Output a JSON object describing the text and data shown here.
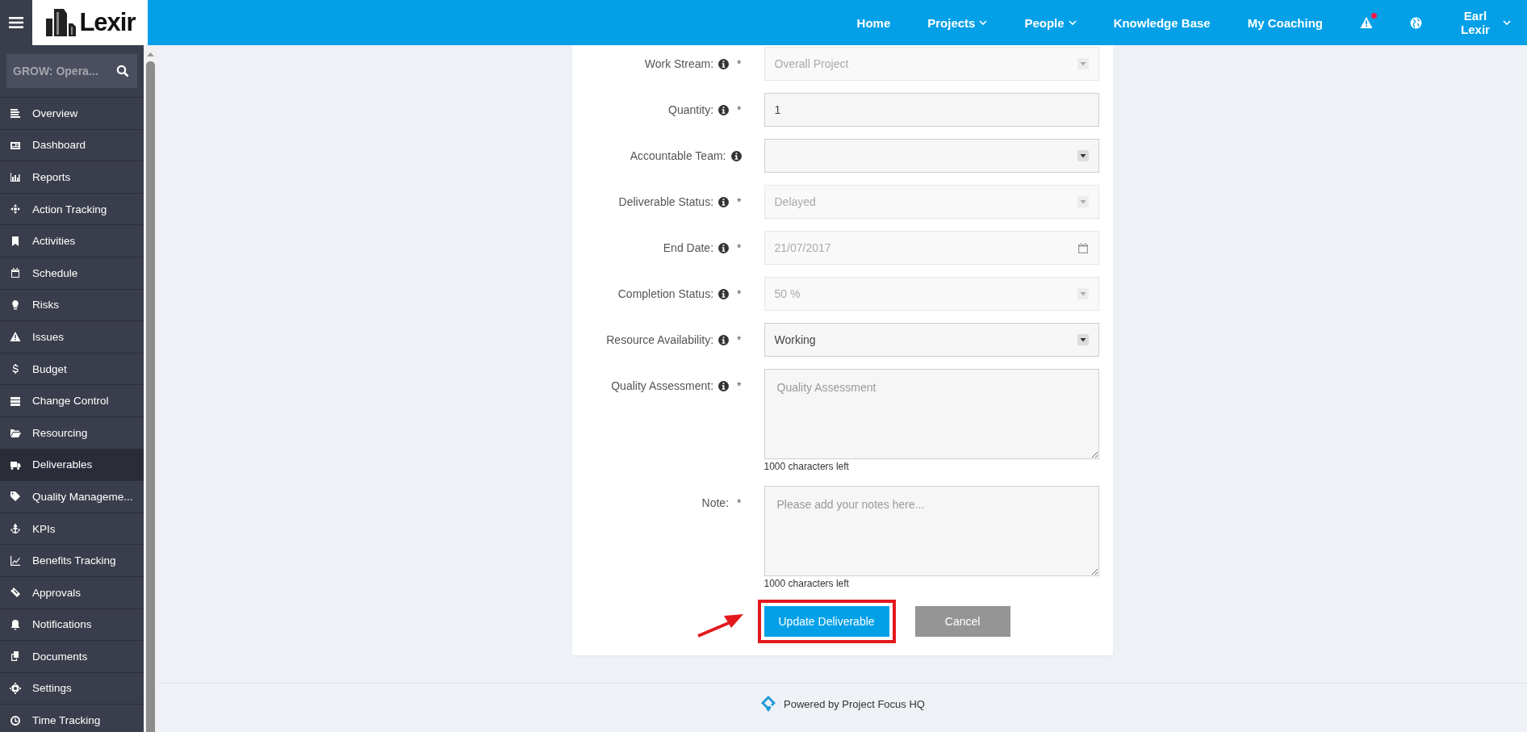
{
  "header": {
    "logo": "Lexir",
    "nav": [
      {
        "label": "Home",
        "dropdown": false
      },
      {
        "label": "Projects",
        "dropdown": true
      },
      {
        "label": "People",
        "dropdown": true
      },
      {
        "label": "Knowledge Base",
        "dropdown": false
      },
      {
        "label": "My Coaching",
        "dropdown": false
      }
    ],
    "alerts": {
      "unread": true
    },
    "user": {
      "name": "Earl Lexir"
    }
  },
  "sidebar": {
    "search": {
      "value": "GROW: Opera..."
    },
    "items": [
      {
        "label": "Overview",
        "selected": false
      },
      {
        "label": "Dashboard",
        "selected": false
      },
      {
        "label": "Reports",
        "selected": false
      },
      {
        "label": "Action Tracking",
        "selected": false
      },
      {
        "label": "Activities",
        "selected": false
      },
      {
        "label": "Schedule",
        "selected": false
      },
      {
        "label": "Risks",
        "selected": false
      },
      {
        "label": "Issues",
        "selected": false
      },
      {
        "label": "Budget",
        "selected": false
      },
      {
        "label": "Change Control",
        "selected": false
      },
      {
        "label": "Resourcing",
        "selected": false
      },
      {
        "label": "Deliverables",
        "selected": true
      },
      {
        "label": "Quality Manageme...",
        "selected": false
      },
      {
        "label": "KPIs",
        "selected": false
      },
      {
        "label": "Benefits Tracking",
        "selected": false
      },
      {
        "label": "Approvals",
        "selected": false
      },
      {
        "label": "Notifications",
        "selected": false
      },
      {
        "label": "Documents",
        "selected": false
      },
      {
        "label": "Settings",
        "selected": false
      },
      {
        "label": "Time Tracking",
        "selected": false
      }
    ]
  },
  "form": {
    "fields": [
      {
        "kind": "select",
        "label": "Work Stream:",
        "info": true,
        "marker": "*",
        "value": "Overall Project",
        "disabled": true
      },
      {
        "kind": "input",
        "label": "Quantity:",
        "info": true,
        "marker": "*",
        "value": "1",
        "disabled": false
      },
      {
        "kind": "select",
        "label": "Accountable Team:",
        "info": true,
        "disabled": false
      },
      {
        "kind": "select",
        "label": "Deliverable Status:",
        "info": true,
        "marker": "*",
        "value": "Delayed",
        "disabled": true
      },
      {
        "kind": "date",
        "label": "End Date:",
        "info": true,
        "marker": "*",
        "value": "21/07/2017",
        "disabled": true
      },
      {
        "kind": "select",
        "label": "Completion Status:",
        "info": true,
        "marker": "*",
        "value": "50 %",
        "disabled": true
      },
      {
        "kind": "select",
        "label": "Resource Availability:",
        "info": true,
        "marker": "*",
        "value": "Working",
        "disabled": false
      },
      {
        "kind": "textarea",
        "label": "Quality Assessment:",
        "info": true,
        "marker": "*",
        "placeholder": "Quality Assessment",
        "counter": "1000 characters left",
        "disabled": false
      },
      {
        "kind": "textarea",
        "label": "Note:",
        "info": false,
        "marker": "*",
        "placeholder": "Please add your notes here...",
        "counter": "1000 characters left",
        "disabled": false
      }
    ],
    "buttons": [
      {
        "kind": "primary",
        "label": "Update Deliverable",
        "highlighted": true
      },
      {
        "kind": "secondary",
        "label": "Cancel",
        "highlighted": false
      }
    ]
  },
  "footer": {
    "text": "Powered by Project Focus HQ"
  }
}
